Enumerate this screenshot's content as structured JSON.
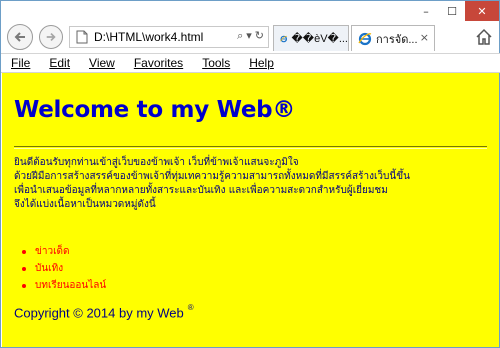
{
  "window": {
    "controls": {
      "minimize": "–",
      "maximize": "☐",
      "close": "✕"
    }
  },
  "navigation": {
    "address": "D:\\HTML\\work4.html",
    "address_icons": {
      "search": "⌕",
      "dropdown": "▾",
      "refresh": "↻"
    }
  },
  "tabs": [
    {
      "label": "��èV�...",
      "active": false
    },
    {
      "label": "การจัด...",
      "active": true,
      "close": "×"
    }
  ],
  "menu": [
    "File",
    "Edit",
    "View",
    "Favorites",
    "Tools",
    "Help"
  ],
  "page": {
    "heading": "Welcome to my Web®",
    "paragraph": [
      "ยินดีต้อนรับทุกท่านเข้าสู่เว็บของข้าพเจ้า เว็บที่ข้าพเจ้าแสนจะภูมิใจ",
      "ด้วยฝีมือการสร้างสรรค์ของข้าพเจ้าที่ทุ่มเทความรู้ความสามารถทั้งหมดที่มีสรรค์สร้างเว็บนี้ขึ้น",
      "เพื่อนำเสนอข้อมูลที่หลากหลายทั้งสาระและบันเทิง และเพื่อความสะดวกสำหรับผู้เยี่ยมชม",
      "จึงได้แบ่งเนื้อหาเป็นหมวดหมู่ดังนี้"
    ],
    "categories": [
      "ข่าวเด็ด",
      "บันเทิง",
      "บทเรียนออนไลน์"
    ],
    "copyright": "Copyright © 2014 by my Web",
    "copyright_mark": "®"
  },
  "colors": {
    "page_background": "#ffff00",
    "heading": "#0000cc",
    "body_text": "#000080",
    "list_text": "#ff0000",
    "close_button": "#c7473a"
  }
}
